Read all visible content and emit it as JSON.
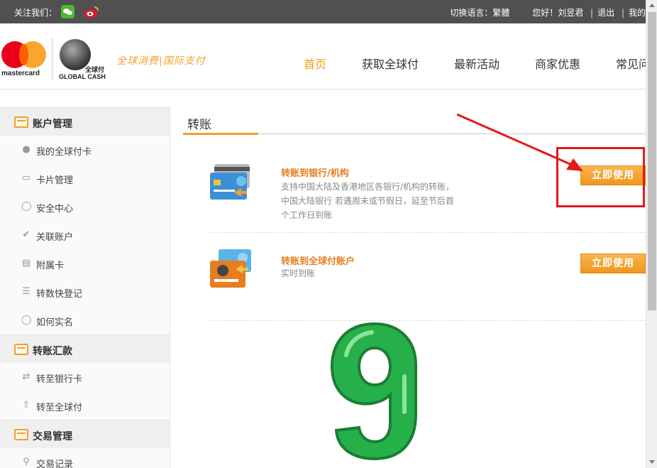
{
  "topbar": {
    "follow_label": "关注我们：",
    "wechat_icon": "wechat-icon",
    "weibo_icon": "weibo-icon",
    "lang_label": "切换语言：",
    "lang_option": "繁體",
    "greeting": "您好！刘昱君",
    "sep": "|",
    "logout": "退出",
    "my": "我的"
  },
  "header": {
    "mastercard_text": "mastercard",
    "global_cash_cn": "全球付",
    "global_cash_en": "GLOBAL CASH",
    "slogan": "全球消费|国际支付",
    "nav": [
      "首页",
      "获取全球付",
      "最新活动",
      "商家优惠",
      "常见问"
    ]
  },
  "sidebar": {
    "sections": [
      {
        "label": "账户管理",
        "items": [
          {
            "label": "我的全球付卡",
            "icon": "user-icon"
          },
          {
            "label": "卡片管理",
            "icon": "card-icon"
          },
          {
            "label": "安全中心",
            "icon": "shield-icon"
          },
          {
            "label": "关联账户",
            "icon": "check-circle-icon"
          },
          {
            "label": "附属卡",
            "icon": "card-outline-icon"
          },
          {
            "label": "转数快登记",
            "icon": "document-icon"
          },
          {
            "label": "如何实名",
            "icon": "id-shield-icon"
          }
        ]
      },
      {
        "label": "转账汇款",
        "items": [
          {
            "label": "转至银行卡",
            "icon": "swap-icon"
          },
          {
            "label": "转至全球付",
            "icon": "upload-icon"
          }
        ]
      },
      {
        "label": "交易管理",
        "items": [
          {
            "label": "交易记录",
            "icon": "search-icon"
          }
        ]
      }
    ]
  },
  "main": {
    "title": "转账",
    "cards": [
      {
        "title": "转账到银行/机构",
        "desc": "支持中国大陆及香港地区各银行/机构的转账，中国大陆银行 若遇周末或节假日，延至节后首个工作日到账",
        "button": "立即使用"
      },
      {
        "title": "转账到全球付账户",
        "desc": "实时到账",
        "button": "立即使用"
      }
    ]
  },
  "colors": {
    "accent": "#f0a030",
    "accent_text": "#e67e22",
    "annotation_red": "#e21a1a",
    "topbar_bg": "#505050",
    "sticker_green": "#2bb24c"
  }
}
